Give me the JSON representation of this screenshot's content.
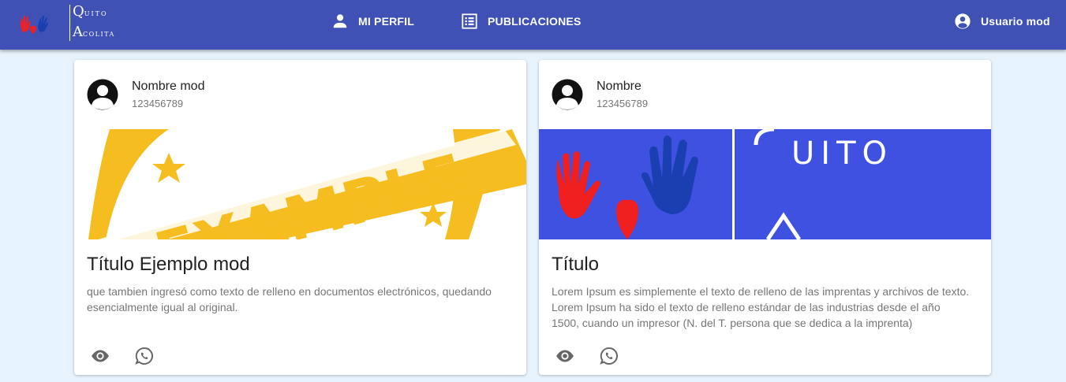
{
  "header": {
    "logo": {
      "word1_initial": "Q",
      "word1_rest": "UITO",
      "word2_initial": "A",
      "word2_rest": "COLITA"
    },
    "nav": [
      {
        "label": "MI PERFIL",
        "icon": "person-icon"
      },
      {
        "label": "PUBLICACIONES",
        "icon": "list-icon"
      }
    ],
    "user": {
      "label": "Usuario mod",
      "icon": "account-circle-icon"
    }
  },
  "cards": [
    {
      "name": "Nombre mod",
      "phone": "123456789",
      "image": "example-stamp-image",
      "image_text": "EXAMPLE",
      "title": "Título Ejemplo mod",
      "text": "que tambien ingresó como texto de relleno en documentos electrónicos, quedando esencialmente igual al original.",
      "actions": [
        "eye-icon",
        "whatsapp-icon"
      ]
    },
    {
      "name": "Nombre",
      "phone": "123456789",
      "image": "quito-acolita-logo-image",
      "image_text": "UITO",
      "title": "Título",
      "text": "Lorem Ipsum es simplemente el texto de relleno de las imprentas y archivos de texto. Lorem Ipsum ha sido el texto de relleno estándar de las industrias desde el año 1500, cuando un impresor (N. del T. persona que se dedica a la imprenta)",
      "actions": [
        "eye-icon",
        "whatsapp-icon"
      ]
    }
  ],
  "colors": {
    "appbar": "#3f51b5",
    "background": "#e6f2fc",
    "example_yellow": "#f5bd1f",
    "logo_blue": "#3f51e0",
    "hand_red": "#f02020",
    "hand_blue": "#1a3fb0"
  }
}
